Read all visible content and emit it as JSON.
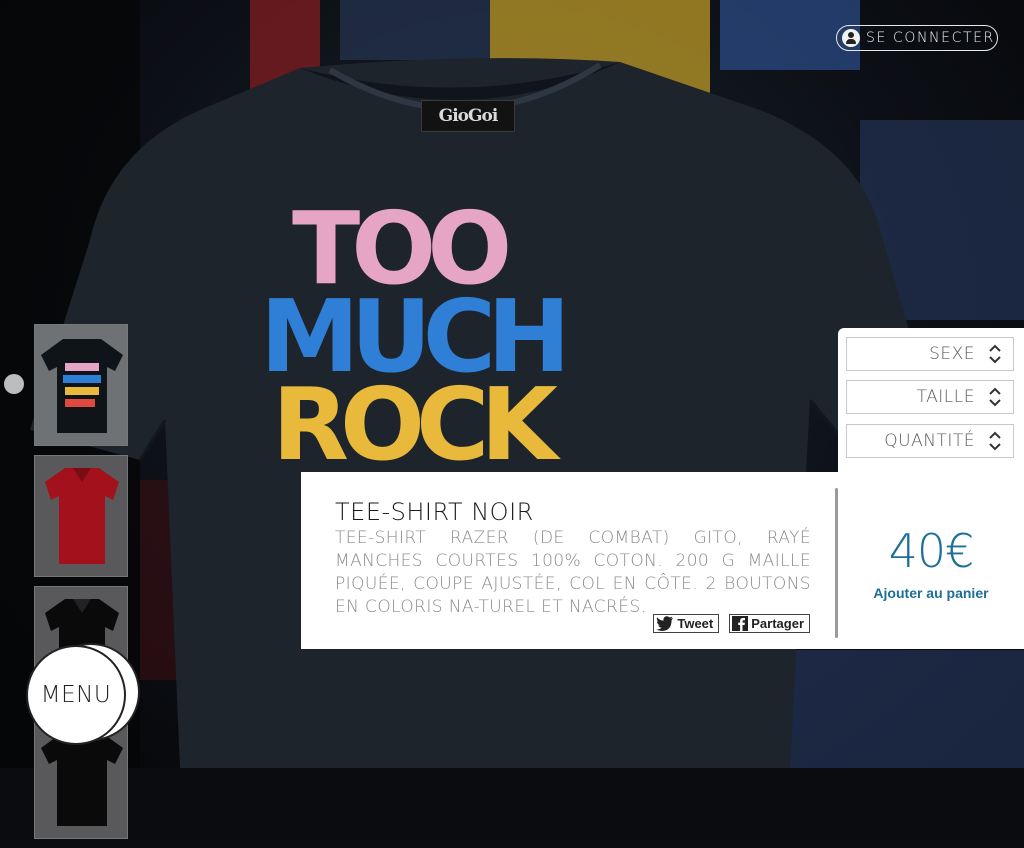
{
  "header": {
    "login_label": "SE CONNECTER",
    "login_icon": "user-icon"
  },
  "product": {
    "neck_label": "GioGoi",
    "print_lines": [
      "TOO",
      "MUCH",
      "ROCK"
    ],
    "title": "TEE-SHIRT NOIR",
    "description": "TEE-SHIRT RAZER (DE COMBAT) GITO, RAYÉ MANCHES COURTES 100% COTON. 200 G MAILLE PIQUÉE, COUPE AJUSTÉE, COL EN CÔTE. 2 BOUTONS EN COLORIS NA-TUREL ET NACRÉS.",
    "price": "40€",
    "add_to_cart": "Ajouter au panier"
  },
  "share": {
    "tweet": "Tweet",
    "share": "Partager"
  },
  "options": {
    "sexe": "SEXE",
    "taille": "TAILLE",
    "quantite": "QUANTITÉ"
  },
  "thumbnails": [
    {
      "name": "black-tee-too-much-rock",
      "color": "#0f1419"
    },
    {
      "name": "red-polo",
      "color": "#a3121c"
    },
    {
      "name": "black-polo",
      "color": "#0a0a0a"
    },
    {
      "name": "black-tee",
      "color": "#0a0a0a"
    }
  ],
  "menu": {
    "label": "MENU"
  },
  "colors": {
    "accent": "#1c6f97",
    "print_pink": "#e6a5c4",
    "print_blue": "#2f7fd6",
    "print_yellow": "#e8b93a"
  }
}
